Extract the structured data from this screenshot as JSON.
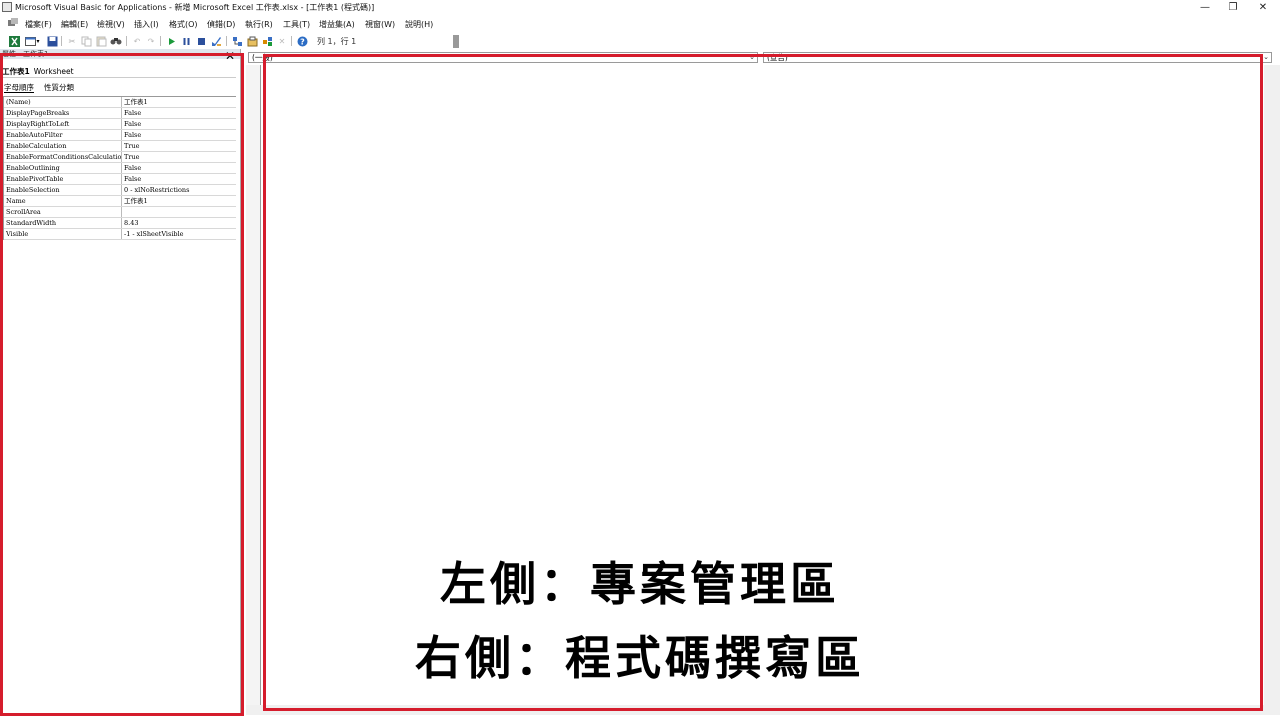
{
  "window": {
    "title": "Microsoft Visual Basic for Applications - 新增 Microsoft Excel 工作表.xlsx - [工作表1 (程式碼)]",
    "controls": {
      "minimize": "—",
      "restore": "❐",
      "close": "✕"
    }
  },
  "menu": {
    "items": [
      "檔案(F)",
      "編輯(E)",
      "檢視(V)",
      "插入(I)",
      "格式(O)",
      "偵錯(D)",
      "執行(R)",
      "工具(T)",
      "增益集(A)",
      "視窗(W)",
      "說明(H)"
    ]
  },
  "toolbar": {
    "position_text": "列 1，行 1",
    "icons": [
      "excel-icon",
      "insert-module-icon",
      "save-icon",
      "cut-icon",
      "copy-icon",
      "paste-icon",
      "find-icon",
      "undo-icon",
      "redo-icon",
      "run-icon",
      "break-icon",
      "reset-icon",
      "design-mode-icon",
      "project-explorer-icon",
      "properties-icon",
      "object-browser-icon",
      "toolbox-icon",
      "help-icon"
    ]
  },
  "properties": {
    "caption": "屬性 - 工作表1",
    "object_name": "工作表1",
    "object_type": "Worksheet",
    "tabs": [
      "字母順序",
      "性質分類"
    ],
    "rows": [
      {
        "name": "(Name)",
        "value": "工作表1"
      },
      {
        "name": "DisplayPageBreaks",
        "value": "False"
      },
      {
        "name": "DisplayRightToLeft",
        "value": "False"
      },
      {
        "name": "EnableAutoFilter",
        "value": "False"
      },
      {
        "name": "EnableCalculation",
        "value": "True"
      },
      {
        "name": "EnableFormatConditionsCalculation",
        "value": "True"
      },
      {
        "name": "EnableOutlining",
        "value": "False"
      },
      {
        "name": "EnablePivotTable",
        "value": "False"
      },
      {
        "name": "EnableSelection",
        "value": "0 - xlNoRestrictions"
      },
      {
        "name": "Name",
        "value": "工作表1"
      },
      {
        "name": "ScrollArea",
        "value": ""
      },
      {
        "name": "StandardWidth",
        "value": "8.43"
      },
      {
        "name": "Visible",
        "value": "-1 - xlSheetVisible"
      }
    ]
  },
  "code": {
    "object_combo": "(一般)",
    "procedure_combo": "(宣告)"
  },
  "overlay": {
    "line1": "左側：專案管理區",
    "line2": "右側：程式碼撰寫區",
    "box_color": "#d51c2c"
  }
}
